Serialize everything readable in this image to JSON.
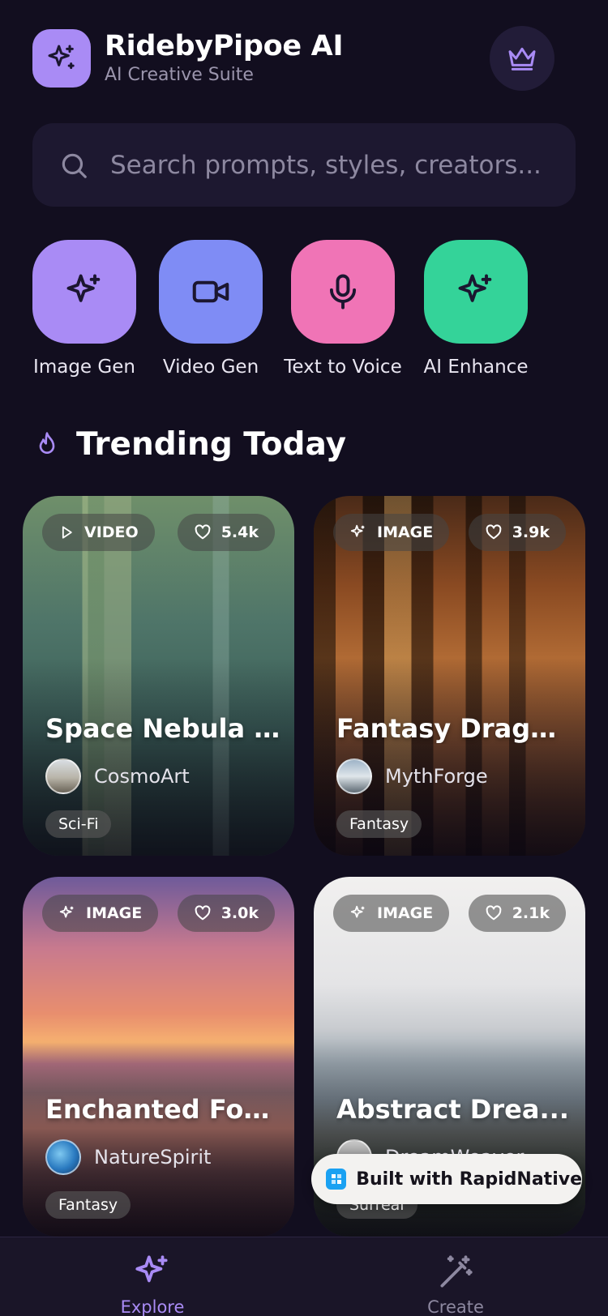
{
  "header": {
    "app_title": "RidebyPipoe AI",
    "subtitle": "AI Creative Suite"
  },
  "search": {
    "placeholder": "Search prompts, styles, creators..."
  },
  "tools": [
    {
      "label": "Image Gen",
      "icon": "sparkles-icon",
      "color": "#a98bf5"
    },
    {
      "label": "Video Gen",
      "icon": "video-camera-icon",
      "color": "#7f8cf5"
    },
    {
      "label": "Text to Voice",
      "icon": "microphone-icon",
      "color": "#f074b6"
    },
    {
      "label": "AI Enhance",
      "icon": "sparkles-icon",
      "color": "#34d399"
    }
  ],
  "section": {
    "title": "Trending Today",
    "icon": "flame-icon"
  },
  "cards": [
    {
      "type": "VIDEO",
      "likes": "5.4k",
      "title": "Space Nebula J...",
      "creator": "CosmoArt",
      "tag": "Sci-Fi"
    },
    {
      "type": "IMAGE",
      "likes": "3.9k",
      "title": "Fantasy Dragon...",
      "creator": "MythForge",
      "tag": "Fantasy"
    },
    {
      "type": "IMAGE",
      "likes": "3.0k",
      "title": "Enchanted Forest",
      "creator": "NatureSpirit",
      "tag": "Fantasy"
    },
    {
      "type": "IMAGE",
      "likes": "2.1k",
      "title": "Abstract Drea...",
      "creator": "DreamWeaver",
      "tag": "Surreal"
    }
  ],
  "badge": {
    "text": "Built with RapidNative"
  },
  "nav": {
    "items": [
      {
        "label": "Explore",
        "active": true,
        "icon": "sparkles-icon"
      },
      {
        "label": "Create",
        "active": false,
        "icon": "magic-wand-icon"
      }
    ]
  },
  "colors": {
    "background": "#120e1f",
    "accent": "#a98bf5"
  }
}
